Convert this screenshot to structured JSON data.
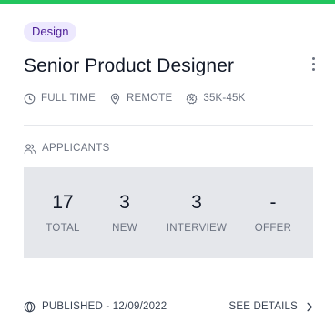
{
  "colors": {
    "accent": "#22c55e",
    "tag_bg": "#ede9fe",
    "tag_text": "#4c1d95",
    "stats_bg": "#e5e7eb"
  },
  "card": {
    "tag": "Design",
    "title": "Senior Product Designer",
    "meta": {
      "job_type": "FULL TIME",
      "location": "REMOTE",
      "salary": "35K-45K"
    },
    "applicants": {
      "label": "APPLICANTS",
      "stats": [
        {
          "value": "17",
          "label": "TOTAL"
        },
        {
          "value": "3",
          "label": "NEW"
        },
        {
          "value": "3",
          "label": "INTERVIEW"
        },
        {
          "value": "-",
          "label": "OFFER"
        }
      ]
    },
    "footer": {
      "published": "PUBLISHED - 12/09/2022",
      "details_link": "SEE DETAILS"
    },
    "icons": {
      "job_type": "clock-icon",
      "location": "map-pin-icon",
      "salary": "money-badge-icon",
      "applicants": "users-icon",
      "published": "globe-icon",
      "details": "chevron-right-icon",
      "more": "more-vertical-icon"
    }
  }
}
